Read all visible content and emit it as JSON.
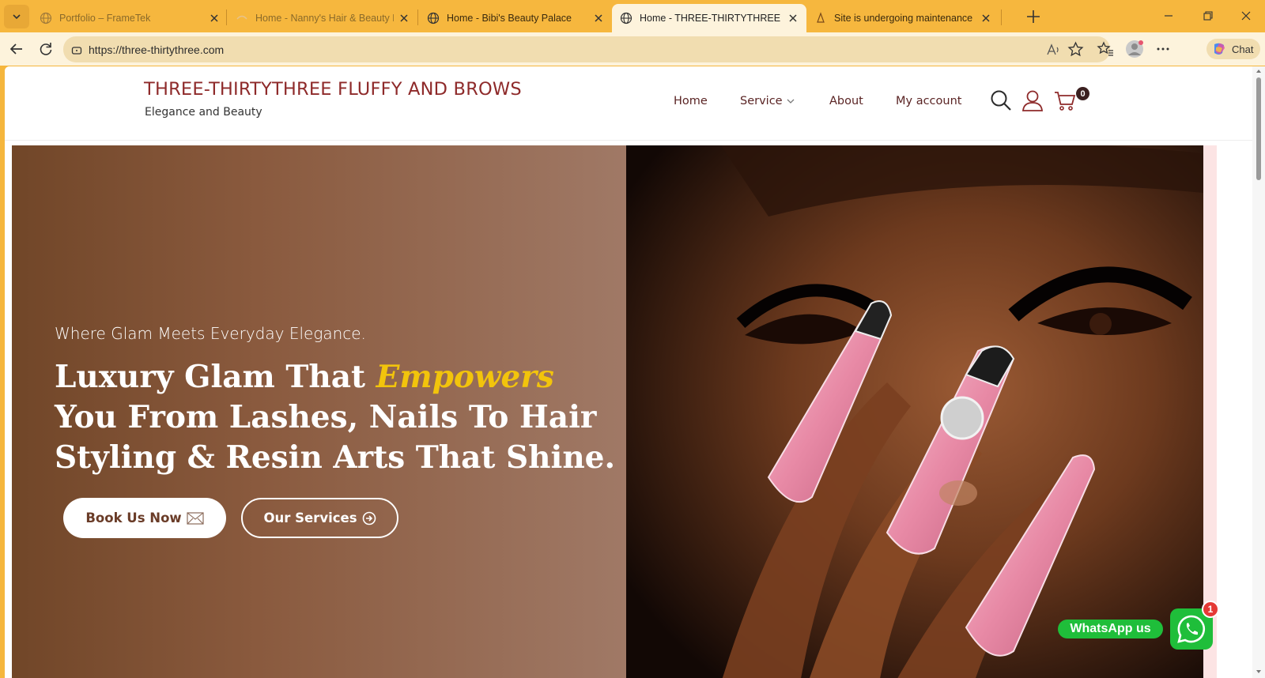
{
  "browser": {
    "tabs": [
      {
        "title": "Portfolio – FrameTek",
        "state": "inactive"
      },
      {
        "title": "Home - Nanny's Hair & Beauty Lo",
        "state": "inactive"
      },
      {
        "title": "Home - Bibi's Beauty Palace",
        "state": "inactive"
      },
      {
        "title": "Home - THREE-THIRTYTHREE FLUF",
        "state": "active"
      },
      {
        "title": "Site is undergoing maintenance",
        "state": "inactive"
      }
    ],
    "url": "https://three-thirtythree.com",
    "chat_label": "Chat"
  },
  "site": {
    "brand": "THREE-THIRTYTHREE FLUFFY AND BROWS",
    "tagline": "Elegance and Beauty",
    "nav": {
      "home": "Home",
      "service": "Service",
      "about": "About",
      "account": "My account"
    },
    "cart_count": "0"
  },
  "hero": {
    "eyebrow": "Where Glam Meets Everyday Elegance.",
    "headline_part1": "Luxury Glam That ",
    "headline_emphasis": "Empowers",
    "headline_part2": " You From Lashes, Nails To Hair Styling & Resin Arts That Shine.",
    "book_button": "Book Us Now",
    "services_button": "Our Services"
  },
  "whatsapp": {
    "label": "WhatsApp us",
    "badge_count": "1"
  },
  "colors": {
    "browser_chrome": "#f6b73e",
    "brand_red": "#8e2a2a",
    "accent_yellow": "#f2c40c",
    "hero_brown": "#714628",
    "whatsapp_green": "#1fbe3a"
  }
}
